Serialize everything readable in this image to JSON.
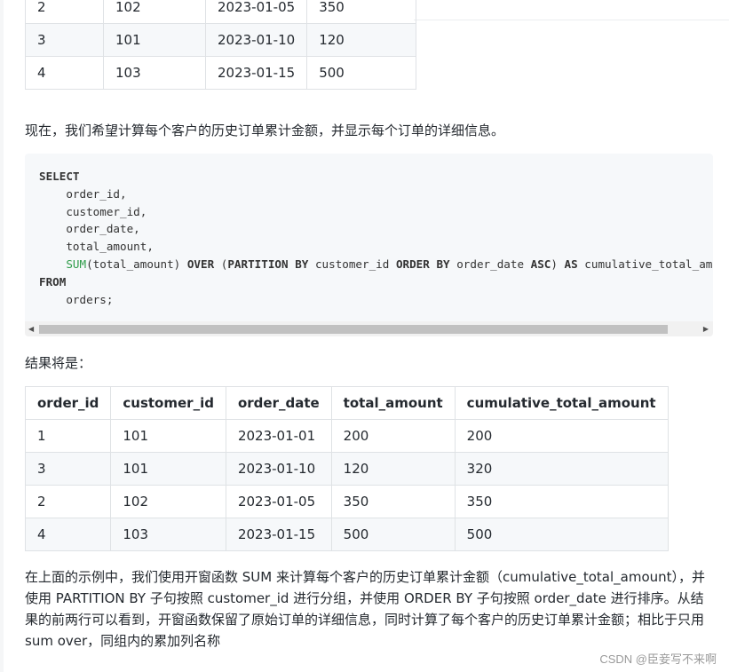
{
  "table1": {
    "rows": [
      [
        "2",
        "102",
        "2023-01-05",
        "350"
      ],
      [
        "3",
        "101",
        "2023-01-10",
        "120"
      ],
      [
        "4",
        "103",
        "2023-01-15",
        "500"
      ]
    ]
  },
  "intro_text": "现在，我们希望计算每个客户的历史订单累计金额，并显示每个订单的详细信息。",
  "code": {
    "select": "SELECT",
    "l1": "    order_id,",
    "l2": "    customer_id,",
    "l3": "    order_date,",
    "l4": "    total_amount,",
    "l5_indent": "    ",
    "l5_fn": "SUM",
    "l5_a": "(total_amount) ",
    "l5_over": "OVER",
    "l5_b": " (",
    "l5_partition": "PARTITION",
    "l5_c": " ",
    "l5_by1": "BY",
    "l5_d": " customer_id ",
    "l5_order": "ORDER",
    "l5_e": " ",
    "l5_by2": "BY",
    "l5_f": " order_date ",
    "l5_asc": "ASC",
    "l5_g": ") ",
    "l5_as": "AS",
    "l5_h": " cumulative_total_amount",
    "from": "FROM",
    "l7": "    orders;"
  },
  "result_label": "结果将是：",
  "table2": {
    "headers": [
      "order_id",
      "customer_id",
      "order_date",
      "total_amount",
      "cumulative_total_amount"
    ],
    "rows": [
      [
        "1",
        "101",
        "2023-01-01",
        "200",
        "200"
      ],
      [
        "3",
        "101",
        "2023-01-10",
        "120",
        "320"
      ],
      [
        "2",
        "102",
        "2023-01-05",
        "350",
        "350"
      ],
      [
        "4",
        "103",
        "2023-01-15",
        "500",
        "500"
      ]
    ]
  },
  "explanation": "在上面的示例中，我们使用开窗函数 SUM 来计算每个客户的历史订单累计金额（cumulative_total_amount），并使用 PARTITION BY 子句按照 customer_id 进行分组，并使用 ORDER BY 子句按照 order_date 进行排序。从结果的前两行可以看到，开窗函数保留了原始订单的详细信息，同时计算了每个客户的历史订单累计金额；相比于只用 sum over，同组内的累加列名称",
  "watermark": "CSDN @臣妾写不来啊",
  "scrollbar": {
    "left_arrow": "◀",
    "right_arrow": "▶"
  },
  "colors": {
    "code_function": "#2e9c49",
    "code_bg": "#f6f8fa",
    "table_border": "#dfe2e5"
  }
}
